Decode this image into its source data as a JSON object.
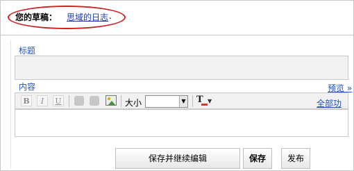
{
  "draft": {
    "label": "您的草稿：",
    "link": "思域的日志",
    "dot": "."
  },
  "form": {
    "title_label": "标题",
    "content_label": "内容",
    "preview_label": "预览 »"
  },
  "toolbar": {
    "bold": "B",
    "italic": "I",
    "underline": "U",
    "size_label": "大小",
    "size_value": "",
    "font_color_glyph": "T",
    "all_features": "全部功能"
  },
  "buttons": {
    "save_continue": "保存并继续编辑",
    "save": "保存",
    "publish": "发布"
  },
  "colors": {
    "highlight_oval": "#d42020",
    "link": "#2152b8"
  }
}
